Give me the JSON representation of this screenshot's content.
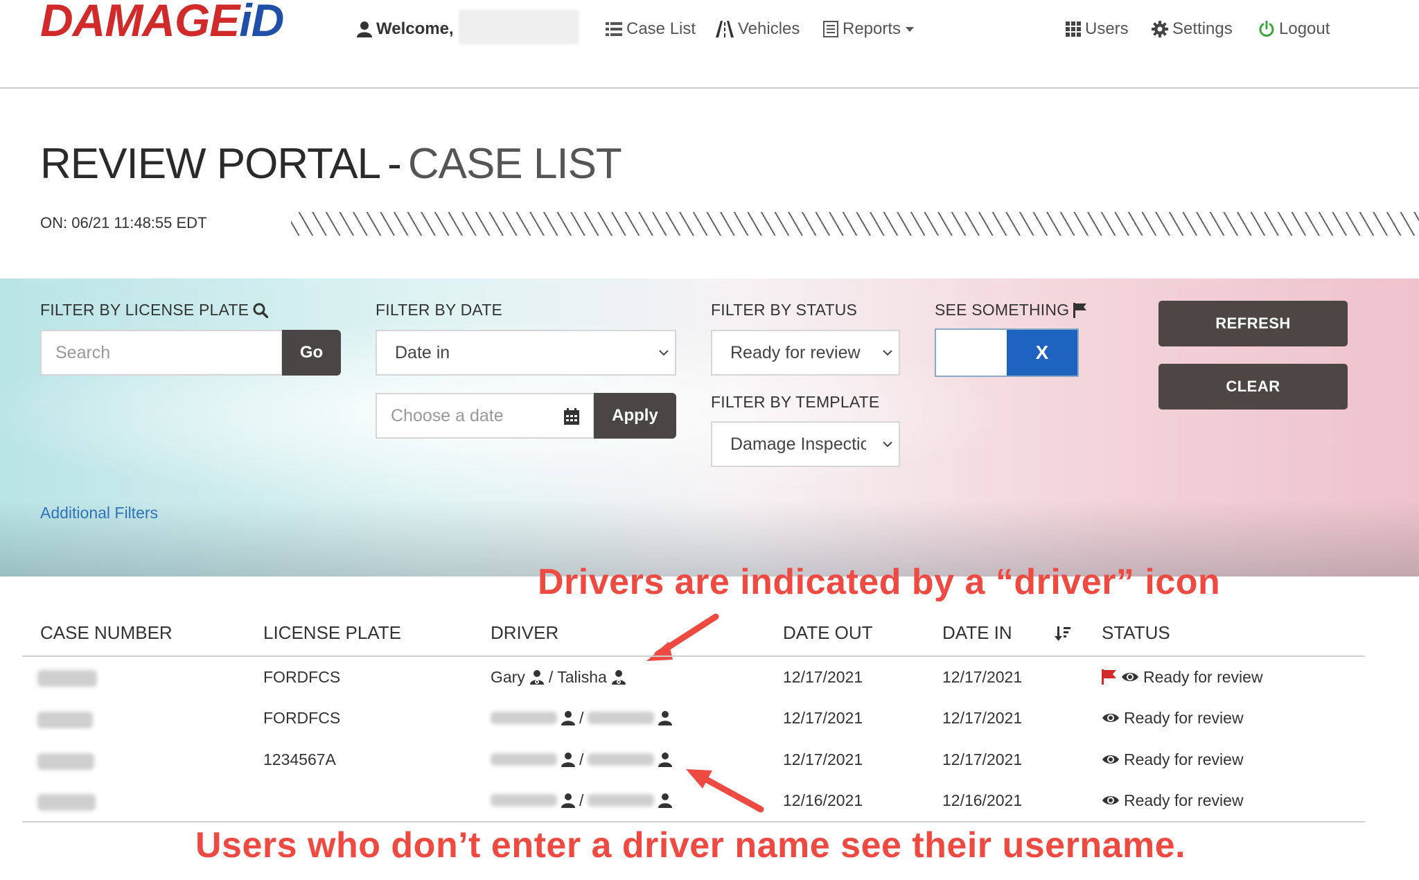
{
  "brand": {
    "part1": "DAMAGE",
    "part2": "iD"
  },
  "nav": {
    "welcome_label": "Welcome,",
    "case_list": "Case List",
    "vehicles": "Vehicles",
    "reports": "Reports",
    "users": "Users",
    "settings": "Settings",
    "logout": "Logout"
  },
  "header": {
    "title_main": "REVIEW PORTAL",
    "title_sep": "-",
    "title_sub": "CASE LIST",
    "timestamp": "ON: 06/21 11:48:55 EDT"
  },
  "filters": {
    "license_plate": {
      "label": "FILTER BY LICENSE PLATE",
      "placeholder": "Search",
      "go": "Go"
    },
    "date": {
      "label": "FILTER BY DATE",
      "selected": "Date in",
      "date_placeholder": "Choose a date",
      "apply": "Apply"
    },
    "status": {
      "label": "FILTER BY STATUS",
      "selected": "Ready for review"
    },
    "template": {
      "label": "FILTER BY TEMPLATE",
      "selected": "Damage Inspection"
    },
    "see_something": {
      "label": "SEE SOMETHING",
      "toggle_value": "X"
    },
    "refresh": "REFRESH",
    "clear": "CLEAR",
    "additional": "Additional Filters"
  },
  "table": {
    "columns": [
      "CASE NUMBER",
      "LICENSE PLATE",
      "DRIVER",
      "DATE OUT",
      "DATE IN",
      "STATUS"
    ],
    "rows": [
      {
        "license_plate": "FORDFCS",
        "driver1": "Gary",
        "driver2": "Talisha",
        "date_out": "12/17/2021",
        "date_in": "12/17/2021",
        "status": "Ready for review",
        "flagged": true
      },
      {
        "license_plate": "FORDFCS",
        "driver1": "",
        "driver2": "",
        "date_out": "12/17/2021",
        "date_in": "12/17/2021",
        "status": "Ready for review",
        "flagged": false
      },
      {
        "license_plate": "1234567A",
        "driver1": "",
        "driver2": "",
        "date_out": "12/17/2021",
        "date_in": "12/17/2021",
        "status": "Ready for review",
        "flagged": false
      },
      {
        "license_plate": "",
        "driver1": "",
        "driver2": "",
        "date_out": "12/16/2021",
        "date_in": "12/16/2021",
        "status": "Ready for review",
        "flagged": false
      }
    ]
  },
  "annotations": {
    "top": "Drivers are indicated by a “driver” icon",
    "bottom": "Users who don’t enter a driver name see their username."
  },
  "colors": {
    "brand_red": "#d02a2a",
    "brand_blue": "#1f4fa6",
    "toggle_blue": "#1f63c0",
    "annotation_red": "#ef4a42",
    "dark_button": "#4a4646"
  }
}
